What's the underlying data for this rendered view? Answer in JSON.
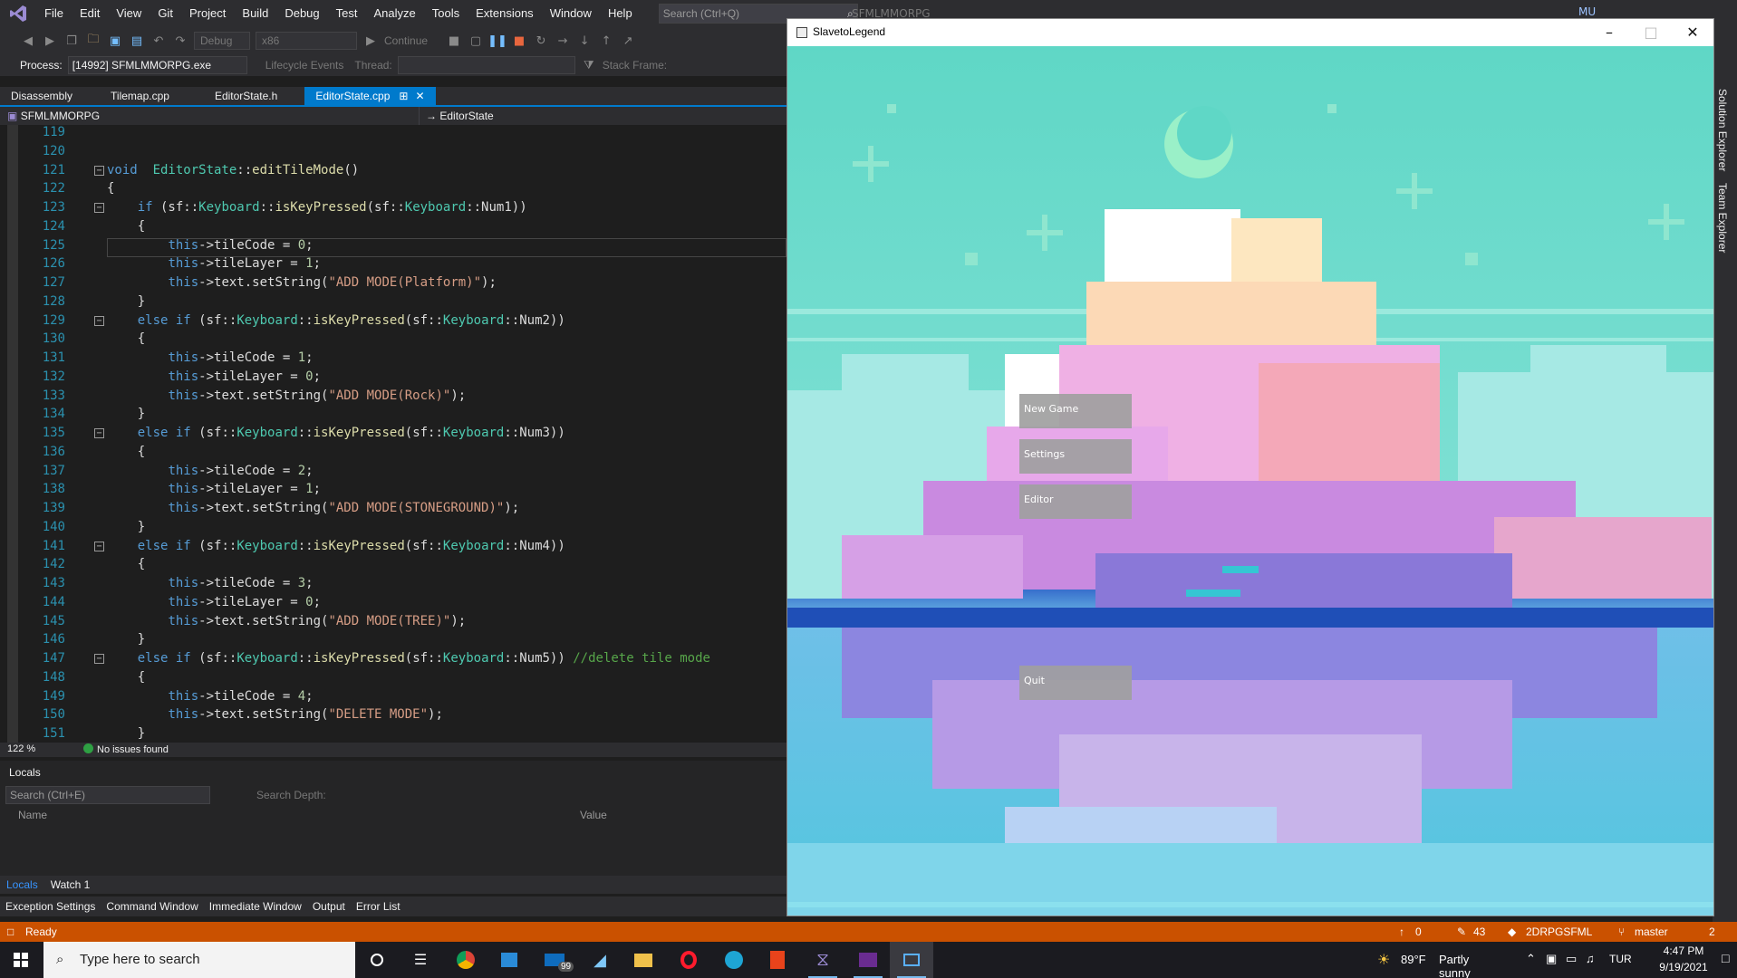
{
  "menu": [
    "File",
    "Edit",
    "View",
    "Git",
    "Project",
    "Build",
    "Debug",
    "Test",
    "Analyze",
    "Tools",
    "Extensions",
    "Window",
    "Help"
  ],
  "search_placeholder": "Search (Ctrl+Q)",
  "solution_name": "SFMLMMORPG",
  "user_initials": "MU",
  "toolbar": {
    "config": "Debug",
    "platform": "x86",
    "continue_label": "Continue",
    "process_label": "Process:",
    "process_value": "[14992] SFMLMMORPG.exe",
    "lifecycle_label": "Lifecycle Events",
    "thread_label": "Thread:",
    "stack_label": "Stack Frame:"
  },
  "tabs": [
    {
      "label": "Disassembly",
      "active": false
    },
    {
      "label": "Tilemap.cpp",
      "active": false
    },
    {
      "label": "EditorState.h",
      "active": false
    },
    {
      "label": "EditorState.cpp",
      "active": true
    }
  ],
  "nav": {
    "project": "SFMLMMORPG",
    "scope": "EditorState"
  },
  "code": {
    "lines": [
      {
        "n": "119",
        "h": []
      },
      {
        "n": "120",
        "h": []
      },
      {
        "n": "121",
        "fold": true,
        "h": [
          [
            "k",
            "void"
          ],
          [
            "",
            "  "
          ],
          [
            "t",
            "EditorState"
          ],
          [
            "",
            "::"
          ],
          [
            "f",
            "editTileMode"
          ],
          [
            "",
            "()"
          ]
        ]
      },
      {
        "n": "122",
        "h": [
          [
            "",
            "{"
          ]
        ]
      },
      {
        "n": "123",
        "fold": true,
        "h": [
          [
            "",
            "    "
          ],
          [
            "k",
            "if"
          ],
          [
            "",
            " (sf::"
          ],
          [
            "t",
            "Keyboard"
          ],
          [
            "",
            "::"
          ],
          [
            "f",
            "isKeyPressed"
          ],
          [
            "",
            "(sf::"
          ],
          [
            "t",
            "Keyboard"
          ],
          [
            "",
            "::Num1))"
          ]
        ]
      },
      {
        "n": "124",
        "h": [
          [
            "",
            "    {"
          ]
        ]
      },
      {
        "n": "125",
        "h": [
          [
            "",
            "        "
          ],
          [
            "k",
            "this"
          ],
          [
            "",
            "->tileCode = "
          ],
          [
            "n",
            "0"
          ],
          [
            "",
            ";"
          ]
        ]
      },
      {
        "n": "126",
        "h": [
          [
            "",
            "        "
          ],
          [
            "k",
            "this"
          ],
          [
            "",
            "->tileLayer = "
          ],
          [
            "n",
            "1"
          ],
          [
            "",
            ";"
          ]
        ]
      },
      {
        "n": "127",
        "h": [
          [
            "",
            "        "
          ],
          [
            "k",
            "this"
          ],
          [
            "",
            "->text.setString("
          ],
          [
            "s",
            "\"ADD MODE(Platform)\""
          ],
          [
            "",
            ");"
          ]
        ]
      },
      {
        "n": "128",
        "h": [
          [
            "",
            "    }"
          ]
        ]
      },
      {
        "n": "129",
        "fold": true,
        "h": [
          [
            "",
            "    "
          ],
          [
            "k",
            "else if"
          ],
          [
            "",
            " (sf::"
          ],
          [
            "t",
            "Keyboard"
          ],
          [
            "",
            "::"
          ],
          [
            "f",
            "isKeyPressed"
          ],
          [
            "",
            "(sf::"
          ],
          [
            "t",
            "Keyboard"
          ],
          [
            "",
            "::Num2))"
          ]
        ]
      },
      {
        "n": "130",
        "h": [
          [
            "",
            "    {"
          ]
        ]
      },
      {
        "n": "131",
        "h": [
          [
            "",
            "        "
          ],
          [
            "k",
            "this"
          ],
          [
            "",
            "->tileCode = "
          ],
          [
            "n",
            "1"
          ],
          [
            "",
            ";"
          ]
        ]
      },
      {
        "n": "132",
        "h": [
          [
            "",
            "        "
          ],
          [
            "k",
            "this"
          ],
          [
            "",
            "->tileLayer = "
          ],
          [
            "n",
            "0"
          ],
          [
            "",
            ";"
          ]
        ]
      },
      {
        "n": "133",
        "h": [
          [
            "",
            "        "
          ],
          [
            "k",
            "this"
          ],
          [
            "",
            "->text.setString("
          ],
          [
            "s",
            "\"ADD MODE(Rock)\""
          ],
          [
            "",
            ");"
          ]
        ]
      },
      {
        "n": "134",
        "h": [
          [
            "",
            "    }"
          ]
        ]
      },
      {
        "n": "135",
        "fold": true,
        "h": [
          [
            "",
            "    "
          ],
          [
            "k",
            "else if"
          ],
          [
            "",
            " (sf::"
          ],
          [
            "t",
            "Keyboard"
          ],
          [
            "",
            "::"
          ],
          [
            "f",
            "isKeyPressed"
          ],
          [
            "",
            "(sf::"
          ],
          [
            "t",
            "Keyboard"
          ],
          [
            "",
            "::Num3))"
          ]
        ]
      },
      {
        "n": "136",
        "h": [
          [
            "",
            "    {"
          ]
        ]
      },
      {
        "n": "137",
        "h": [
          [
            "",
            "        "
          ],
          [
            "k",
            "this"
          ],
          [
            "",
            "->tileCode = "
          ],
          [
            "n",
            "2"
          ],
          [
            "",
            ";"
          ]
        ]
      },
      {
        "n": "138",
        "h": [
          [
            "",
            "        "
          ],
          [
            "k",
            "this"
          ],
          [
            "",
            "->tileLayer = "
          ],
          [
            "n",
            "1"
          ],
          [
            "",
            ";"
          ]
        ]
      },
      {
        "n": "139",
        "h": [
          [
            "",
            "        "
          ],
          [
            "k",
            "this"
          ],
          [
            "",
            "->text.setString("
          ],
          [
            "s",
            "\"ADD MODE(STONEGROUND)\""
          ],
          [
            "",
            ");"
          ]
        ]
      },
      {
        "n": "140",
        "h": [
          [
            "",
            "    }"
          ]
        ]
      },
      {
        "n": "141",
        "fold": true,
        "h": [
          [
            "",
            "    "
          ],
          [
            "k",
            "else if"
          ],
          [
            "",
            " (sf::"
          ],
          [
            "t",
            "Keyboard"
          ],
          [
            "",
            "::"
          ],
          [
            "f",
            "isKeyPressed"
          ],
          [
            "",
            "(sf::"
          ],
          [
            "t",
            "Keyboard"
          ],
          [
            "",
            "::Num4))"
          ]
        ]
      },
      {
        "n": "142",
        "h": [
          [
            "",
            "    {"
          ]
        ]
      },
      {
        "n": "143",
        "h": [
          [
            "",
            "        "
          ],
          [
            "k",
            "this"
          ],
          [
            "",
            "->tileCode = "
          ],
          [
            "n",
            "3"
          ],
          [
            "",
            ";"
          ]
        ]
      },
      {
        "n": "144",
        "h": [
          [
            "",
            "        "
          ],
          [
            "k",
            "this"
          ],
          [
            "",
            "->tileLayer = "
          ],
          [
            "n",
            "0"
          ],
          [
            "",
            ";"
          ]
        ]
      },
      {
        "n": "145",
        "h": [
          [
            "",
            "        "
          ],
          [
            "k",
            "this"
          ],
          [
            "",
            "->text.setString("
          ],
          [
            "s",
            "\"ADD MODE(TREE)\""
          ],
          [
            "",
            ");"
          ]
        ]
      },
      {
        "n": "146",
        "h": [
          [
            "",
            "    }"
          ]
        ]
      },
      {
        "n": "147",
        "fold": true,
        "h": [
          [
            "",
            "    "
          ],
          [
            "k",
            "else if"
          ],
          [
            "",
            " (sf::"
          ],
          [
            "t",
            "Keyboard"
          ],
          [
            "",
            "::"
          ],
          [
            "f",
            "isKeyPressed"
          ],
          [
            "",
            "(sf::"
          ],
          [
            "t",
            "Keyboard"
          ],
          [
            "",
            "::Num5)) "
          ],
          [
            "c",
            "//delete tile mode"
          ]
        ]
      },
      {
        "n": "148",
        "h": [
          [
            "",
            "    {"
          ]
        ]
      },
      {
        "n": "149",
        "h": [
          [
            "",
            "        "
          ],
          [
            "k",
            "this"
          ],
          [
            "",
            "->tileCode = "
          ],
          [
            "n",
            "4"
          ],
          [
            "",
            ";"
          ]
        ]
      },
      {
        "n": "150",
        "h": [
          [
            "",
            "        "
          ],
          [
            "k",
            "this"
          ],
          [
            "",
            "->text.setString("
          ],
          [
            "s",
            "\"DELETE MODE\""
          ],
          [
            "",
            ");"
          ]
        ]
      },
      {
        "n": "151",
        "h": [
          [
            "",
            "    }"
          ]
        ]
      }
    ]
  },
  "editor_status": {
    "zoom": "122 %",
    "issues": "No issues found"
  },
  "locals": {
    "title": "Locals",
    "search_placeholder": "Search (Ctrl+E)",
    "search_depth": "Search Depth:",
    "col_name": "Name",
    "col_value": "Value",
    "tabs": [
      "Locals",
      "Watch 1"
    ]
  },
  "bottom_tabs": [
    "Exception Settings",
    "Command Window",
    "Immediate Window",
    "Output",
    "Error List"
  ],
  "status": {
    "ready": "Ready",
    "up": "0",
    "edits": "43",
    "repo": "2DRPGSFML",
    "branch": "master",
    "notifications": "2"
  },
  "side_panels": [
    "Solution Explorer",
    "Team Explorer"
  ],
  "game": {
    "title": "SlavetoLegend",
    "buttons": [
      "New Game",
      "Settings",
      "Editor",
      "Quit"
    ]
  },
  "taskbar": {
    "search_placeholder": "Type here to search",
    "mail_badge": "99",
    "temperature": "89°F",
    "weather": "Partly sunny",
    "language": "TUR",
    "time": "4:47 PM",
    "date": "9/19/2021"
  },
  "colors": {
    "accent": "#007acc",
    "status_bar": "#ca5100",
    "sky": "#5ed3c0",
    "cloud_pink": "#e9a0e6"
  }
}
